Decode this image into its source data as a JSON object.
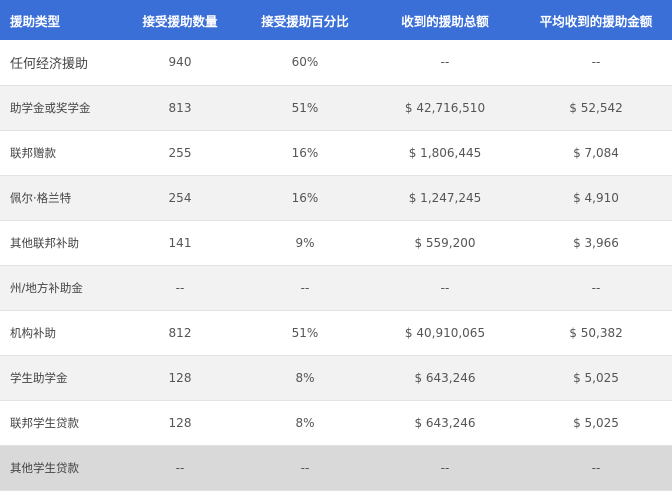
{
  "table": {
    "headers": [
      "援助类型",
      "接受援助数量",
      "接受援助百分比",
      "收到的援助总额",
      "平均收到的援助金额"
    ],
    "rows": [
      {
        "type": "任何经济援助",
        "count": "940",
        "percent": "60%",
        "total": "--",
        "average": "--"
      },
      {
        "type": "助学金或奖学金",
        "count": "813",
        "percent": "51%",
        "total": "$ 42,716,510",
        "average": "$ 52,542"
      },
      {
        "type": "联邦赠款",
        "count": "255",
        "percent": "16%",
        "total": "$ 1,806,445",
        "average": "$ 7,084"
      },
      {
        "type": "佩尔·格兰特",
        "count": "254",
        "percent": "16%",
        "total": "$ 1,247,245",
        "average": "$ 4,910"
      },
      {
        "type": "其他联邦补助",
        "count": "141",
        "percent": "9%",
        "total": "$ 559,200",
        "average": "$ 3,966"
      },
      {
        "type": "州/地方补助金",
        "count": "--",
        "percent": "--",
        "total": "--",
        "average": "--"
      },
      {
        "type": "机构补助",
        "count": "812",
        "percent": "51%",
        "total": "$ 40,910,065",
        "average": "$ 50,382"
      },
      {
        "type": "学生助学金",
        "count": "128",
        "percent": "8%",
        "total": "$ 643,246",
        "average": "$ 5,025"
      },
      {
        "type": "联邦学生贷款",
        "count": "128",
        "percent": "8%",
        "total": "$ 643,246",
        "average": "$ 5,025"
      },
      {
        "type": "其他学生贷款",
        "count": "--",
        "percent": "--",
        "total": "--",
        "average": "--"
      }
    ]
  }
}
